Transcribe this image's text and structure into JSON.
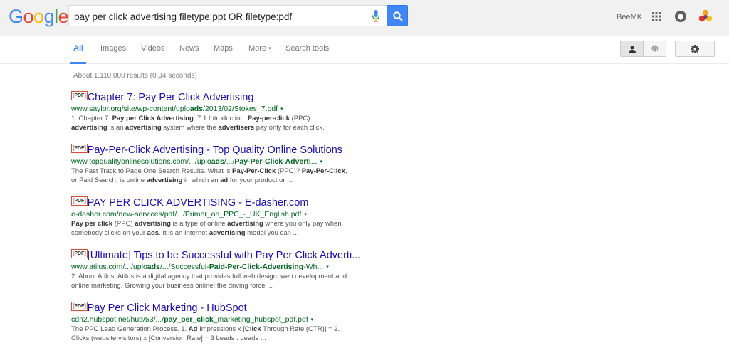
{
  "logo": {
    "letters": [
      "G",
      "o",
      "o",
      "g",
      "l",
      "e"
    ],
    "colors": [
      "#4285f4",
      "#ea4335",
      "#fbbc05",
      "#4285f4",
      "#34a853",
      "#ea4335"
    ]
  },
  "search": {
    "query": "pay per click advertising filetype:ppt OR filetype:pdf"
  },
  "account": {
    "user_name": "BeeMK"
  },
  "nav": {
    "tabs": [
      "All",
      "Images",
      "Videos",
      "News",
      "Maps",
      "More",
      "Search tools"
    ],
    "more_caret": "▾"
  },
  "stats": "About 1,110,000 results (0.34 seconds)",
  "results": [
    {
      "tag": "[PDF]",
      "title": "Chapter 7: Pay Per Click Advertising",
      "url_parts": [
        [
          "www.saylor.org/site/wp-content/uplo",
          false
        ],
        [
          "ads",
          true
        ],
        [
          "/2013/02/Stokes_7.pdf",
          false
        ]
      ],
      "snippet_parts": [
        [
          "1. Chapter 7. ",
          false
        ],
        [
          "Pay per Click Advertising",
          true
        ],
        [
          ". 7.1 Introduction. ",
          false
        ],
        [
          "Pay-per-click",
          true
        ],
        [
          " (PPC) ",
          false
        ],
        [
          "advertising",
          true
        ],
        [
          " is an ",
          false
        ],
        [
          "advertising",
          true
        ],
        [
          " system where the ",
          false
        ],
        [
          "advertisers",
          true
        ],
        [
          " pay only for each click.",
          false
        ]
      ]
    },
    {
      "tag": "[PDF]",
      "title": "Pay-Per-Click Advertising - Top Quality Online Solutions",
      "url_parts": [
        [
          "www.topqualityonlinesolutions.com/.../uplo",
          false
        ],
        [
          "ads",
          true
        ],
        [
          "/.../",
          false
        ],
        [
          "Pay-Per-Click-Adverti",
          true
        ],
        [
          "...",
          false
        ]
      ],
      "snippet_parts": [
        [
          "The Fast Track to Page One Search Results. What is ",
          false
        ],
        [
          "Pay-Per-Click",
          true
        ],
        [
          " (PPC)? ",
          false
        ],
        [
          "Pay-Per-Click",
          true
        ],
        [
          ", or Paid Search, is online ",
          false
        ],
        [
          "advertising",
          true
        ],
        [
          " in which an ",
          false
        ],
        [
          "ad",
          true
        ],
        [
          " for your product or ...",
          false
        ]
      ]
    },
    {
      "tag": "[PDF]",
      "title": "PAY PER CLICK ADVERTISING - E-dasher.com",
      "url_parts": [
        [
          "e-dasher.com/new-services/pdf/.../Primer_on_PPC_-_UK_English.pdf",
          false
        ]
      ],
      "snippet_parts": [
        [
          "Pay per click",
          true
        ],
        [
          " (PPC) ",
          false
        ],
        [
          "advertising",
          true
        ],
        [
          " is a type of online ",
          false
        ],
        [
          "advertising",
          true
        ],
        [
          " where you only pay when somebody clicks on your ",
          false
        ],
        [
          "ads",
          true
        ],
        [
          ". It is an Internet ",
          false
        ],
        [
          "advertising",
          true
        ],
        [
          " model you can ...",
          false
        ]
      ]
    },
    {
      "tag": "[PDF]",
      "title": "[Ultimate] Tips to be Successful with Pay Per Click Adverti...",
      "url_parts": [
        [
          "www.atilus.com/.../uplo",
          false
        ],
        [
          "ads",
          true
        ],
        [
          "/.../Successful-",
          false
        ],
        [
          "Paid-Per-Click-Advertising",
          true
        ],
        [
          "-Wh...",
          false
        ]
      ],
      "snippet_parts": [
        [
          "2. About Atilus. Atilus is a digital agency that provides full web design, web development and online marketing. Growing your business online: the driving force ...",
          false
        ]
      ]
    },
    {
      "tag": "[PDF]",
      "title": "Pay Per Click Marketing - HubSpot",
      "url_parts": [
        [
          "cdn2.hubspot.net/hub/53/.../",
          false
        ],
        [
          "pay_per_click",
          true
        ],
        [
          "_marketing_hubspot_pdf.pdf",
          false
        ]
      ],
      "snippet_parts": [
        [
          "The PPC Lead Generation Process. 1. ",
          false
        ],
        [
          "Ad",
          true
        ],
        [
          " Impressions x [",
          false
        ],
        [
          "Click",
          true
        ],
        [
          " Through Rate (CTR)] = 2. Clicks (website visitors) x [Conversion Rate] = 3 Leads . Leads ...",
          false
        ]
      ]
    }
  ],
  "url_caret": "▾",
  "colors": {
    "link": "#1a0dab",
    "url": "#006621",
    "accent": "#4285f4"
  }
}
